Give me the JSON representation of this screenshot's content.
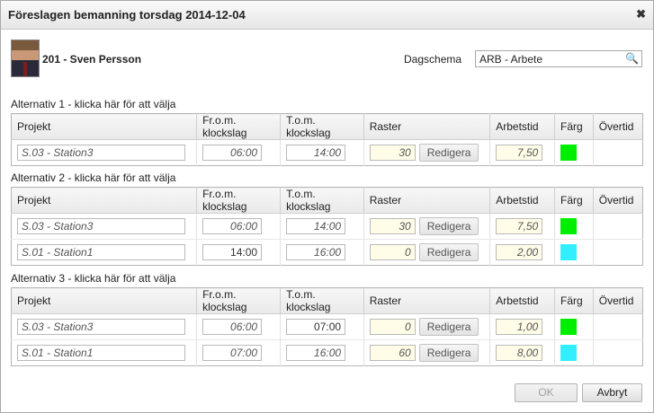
{
  "dialog": {
    "title": "Föreslagen bemanning torsdag 2014-12-04",
    "close_glyph": "✖"
  },
  "person": {
    "name": "201 - Sven Persson"
  },
  "schedule": {
    "label": "Dagschema",
    "value": "ARB - Arbete"
  },
  "columns": [
    "Projekt",
    "Fr.o.m. klockslag",
    "T.o.m. klockslag",
    "Raster",
    "Arbetstid",
    "Färg",
    "Övertid"
  ],
  "edit_label": "Redigera",
  "alternatives": [
    {
      "title": "Alternativ 1 - klicka här för att välja",
      "rows": [
        {
          "project": "S.03 - Station3",
          "from": "06:00",
          "to": "14:00",
          "break": "30",
          "worktime": "7,50",
          "color": "#00ee00",
          "italic": {
            "project": true,
            "from": true,
            "to": true
          }
        }
      ]
    },
    {
      "title": "Alternativ 2 - klicka här för att välja",
      "rows": [
        {
          "project": "S.03 - Station3",
          "from": "06:00",
          "to": "14:00",
          "break": "30",
          "worktime": "7,50",
          "color": "#00ee00",
          "italic": {
            "project": true,
            "from": true,
            "to": true
          }
        },
        {
          "project": "S.01 - Station1",
          "from": "14:00",
          "to": "16:00",
          "break": "0",
          "worktime": "2,00",
          "color": "#33eeff",
          "italic": {
            "project": true,
            "from": false,
            "to": true
          }
        }
      ]
    },
    {
      "title": "Alternativ 3 - klicka här för att välja",
      "rows": [
        {
          "project": "S.03 - Station3",
          "from": "06:00",
          "to": "07:00",
          "break": "0",
          "worktime": "1,00",
          "color": "#00ee00",
          "italic": {
            "project": true,
            "from": true,
            "to": false
          }
        },
        {
          "project": "S.01 - Station1",
          "from": "07:00",
          "to": "16:00",
          "break": "60",
          "worktime": "8,00",
          "color": "#33eeff",
          "italic": {
            "project": true,
            "from": true,
            "to": true
          }
        }
      ]
    }
  ],
  "footer": {
    "ok": "OK",
    "cancel": "Avbryt"
  }
}
